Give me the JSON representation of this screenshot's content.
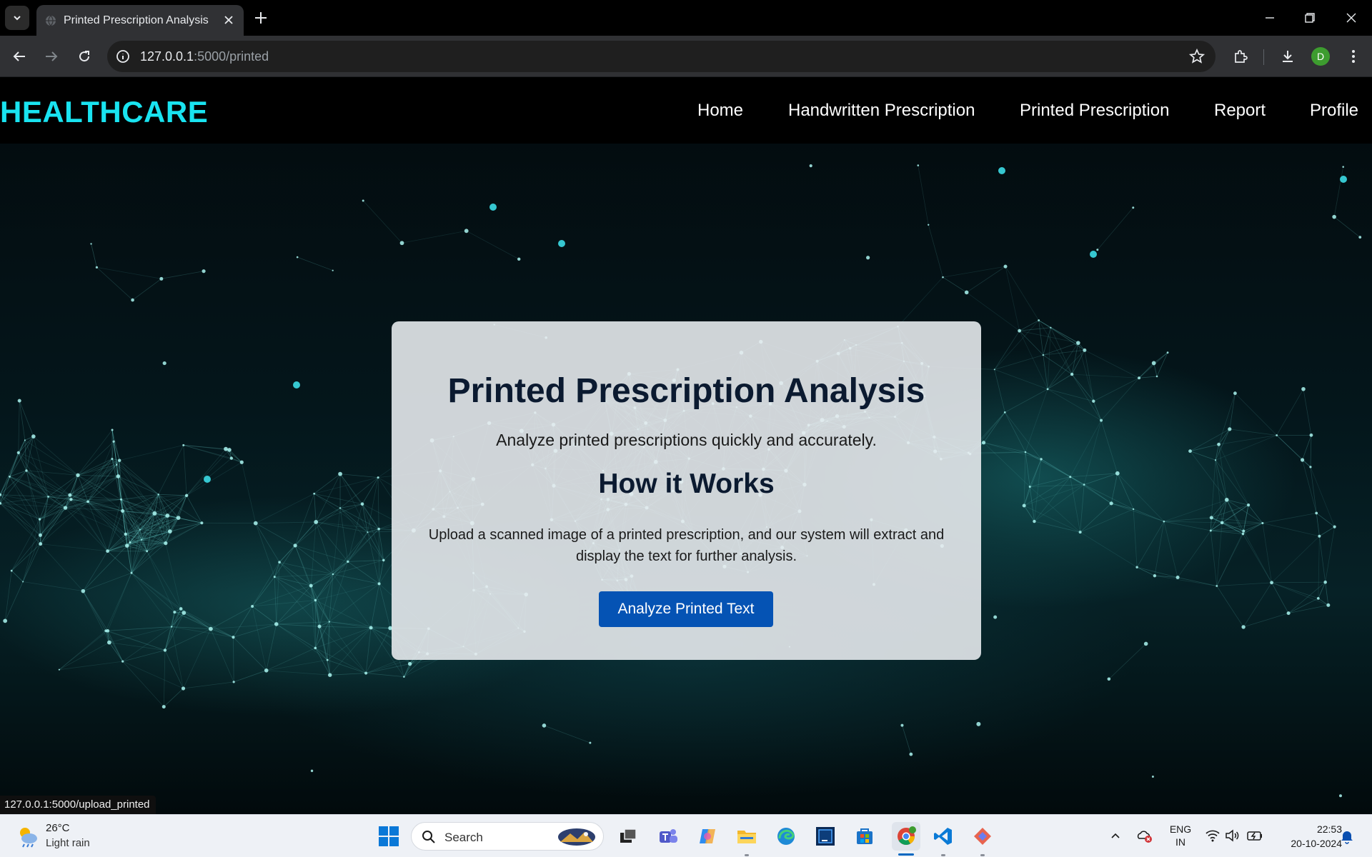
{
  "browser": {
    "tab_title": "Printed Prescription Analysis",
    "url_host": "127.0.0.1",
    "url_path": ":5000/printed",
    "profile_initial": "D",
    "status_url": "127.0.0.1:5000/upload_printed"
  },
  "site": {
    "brand": "HEALTHCARE",
    "nav": [
      {
        "label": "Home"
      },
      {
        "label": "Handwritten Prescription"
      },
      {
        "label": "Printed Prescription"
      },
      {
        "label": "Report"
      },
      {
        "label": "Profile"
      }
    ]
  },
  "card": {
    "title": "Printed Prescription Analysis",
    "subtitle": "Analyze printed prescriptions quickly and accurately.",
    "section_heading": "How it Works",
    "description": "Upload a scanned image of a printed prescription, and our system will extract and display the text for further analysis.",
    "button_label": "Analyze Printed Text"
  },
  "taskbar": {
    "weather_temp": "26°C",
    "weather_desc": "Light rain",
    "search_placeholder": "Search",
    "lang_top": "ENG",
    "lang_bottom": "IN",
    "time": "22:53",
    "date": "20-10-2024"
  },
  "colors": {
    "brand": "#19e3f0",
    "button": "#0553b4",
    "card_bg": "#e9ecef"
  }
}
